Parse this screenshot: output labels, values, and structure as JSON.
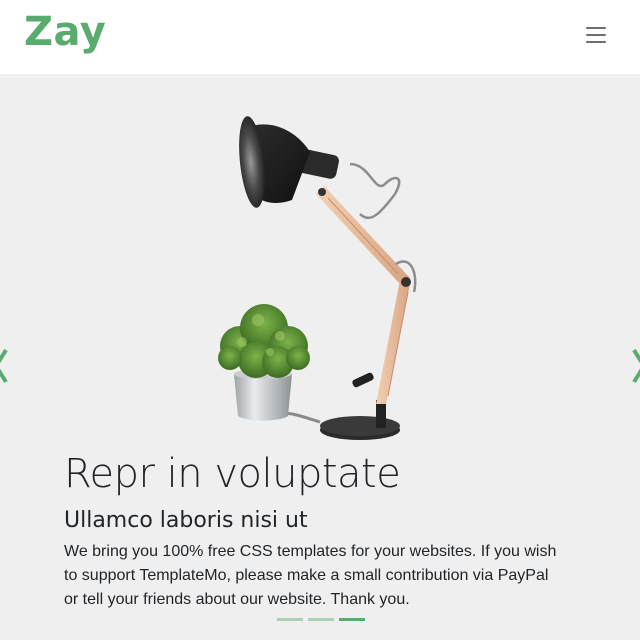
{
  "header": {
    "logo": "Zay",
    "menu_icon": "hamburger-menu-icon"
  },
  "hero": {
    "title": "Repr in voluptate",
    "subtitle": "Ullamco laboris nisi ut",
    "text": "We bring you 100% free CSS templates for your websites. If you wish to support TemplateMo, please make a small contribution via PayPal or tell your friends about our website. Thank you.",
    "image": "desk-lamp-and-plant"
  },
  "carousel": {
    "prev_icon": "chevron-left-icon",
    "next_icon": "chevron-right-icon",
    "slide_count": 3,
    "active_slide": 3
  },
  "colors": {
    "brand": "#59ab6e",
    "background": "#efefef",
    "text": "#212529"
  }
}
